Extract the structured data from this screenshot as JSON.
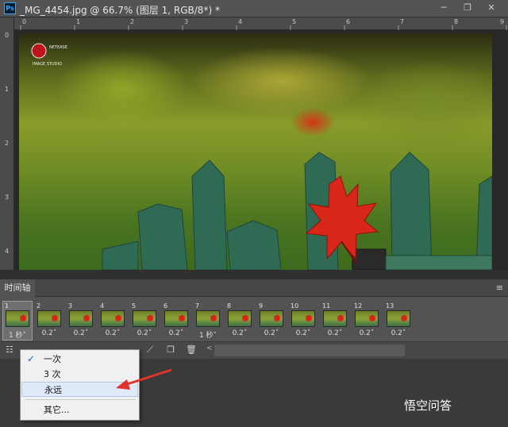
{
  "window": {
    "title": "_MG_4454.jpg @ 66.7% (图层 1, RGB/8*) *",
    "logo": "Ps",
    "controls": [
      "minimize",
      "restore",
      "close"
    ]
  },
  "ruler": {
    "top_ticks": [
      "0",
      "1",
      "2",
      "3",
      "4",
      "5",
      "6",
      "7",
      "8",
      "9"
    ],
    "left_ticks": [
      "0",
      "1",
      "2",
      "3",
      "4"
    ]
  },
  "image": {
    "logo_lines": [
      "NETEASE",
      "IMAGE STUDIO"
    ]
  },
  "panel": {
    "tab_label": "时间轴",
    "menu_icon": "panel-menu-icon"
  },
  "frames": [
    {
      "num": "1",
      "delay": "1 秒˅"
    },
    {
      "num": "2",
      "delay": "0.2˅"
    },
    {
      "num": "3",
      "delay": "0.2˅"
    },
    {
      "num": "4",
      "delay": "0.2˅"
    },
    {
      "num": "5",
      "delay": "0.2˅"
    },
    {
      "num": "6",
      "delay": "0.2˅"
    },
    {
      "num": "7",
      "delay": "1 秒˅"
    },
    {
      "num": "8",
      "delay": "0.2˅"
    },
    {
      "num": "9",
      "delay": "0.2˅"
    },
    {
      "num": "10",
      "delay": "0.2˅"
    },
    {
      "num": "11",
      "delay": "0.2˅"
    },
    {
      "num": "12",
      "delay": "0.2˅"
    },
    {
      "num": "13",
      "delay": "0.2˅"
    }
  ],
  "selected_frame": 1,
  "loop_menu": {
    "items": [
      {
        "label": "一次",
        "checked": true
      },
      {
        "label": "3 次",
        "checked": false
      },
      {
        "label": "永远",
        "checked": false
      },
      {
        "label": "其它...",
        "checked": false
      }
    ]
  },
  "watermark": "悟空问答",
  "colors": {
    "accent_blue": "#31a8ff",
    "leaf_red": "#d8261a",
    "annotation_arrow": "#e0342a",
    "panel_bg": "#535353"
  }
}
